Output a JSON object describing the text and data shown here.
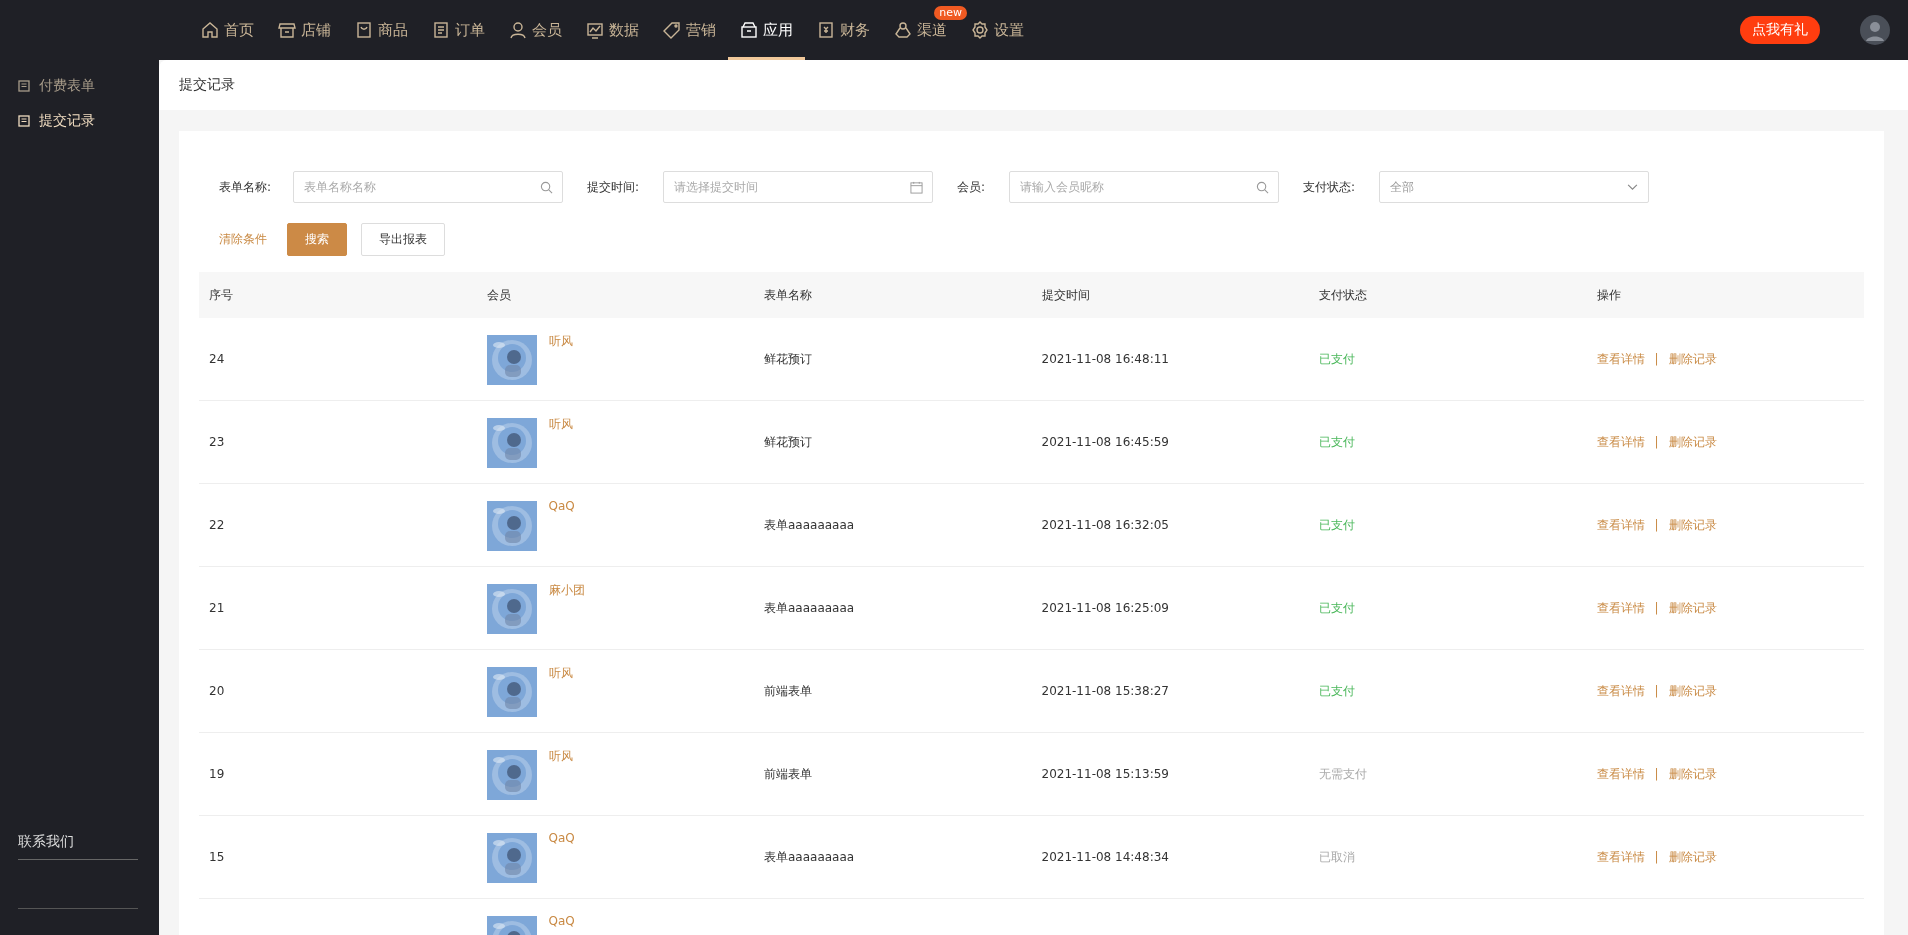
{
  "nav": {
    "items": [
      {
        "label": "首页",
        "selected": false
      },
      {
        "label": "店铺",
        "selected": false
      },
      {
        "label": "商品",
        "selected": false
      },
      {
        "label": "订单",
        "selected": false
      },
      {
        "label": "会员",
        "selected": false
      },
      {
        "label": "数据",
        "selected": false
      },
      {
        "label": "营销",
        "selected": false
      },
      {
        "label": "应用",
        "selected": true
      },
      {
        "label": "财务",
        "selected": false
      },
      {
        "label": "渠道",
        "selected": false,
        "badge": "new"
      },
      {
        "label": "设置",
        "selected": false
      }
    ],
    "promo_button": "点我有礼"
  },
  "sidebar": {
    "items": [
      {
        "label": "付费表单",
        "selected": false
      },
      {
        "label": "提交记录",
        "selected": true
      }
    ],
    "footer_title": "联系我们"
  },
  "page_title": "提交记录",
  "filters": {
    "fields": [
      {
        "label": "表单名称:",
        "placeholder": "表单名称名称",
        "kind": "search"
      },
      {
        "label": "提交时间:",
        "placeholder": "请选择提交时间",
        "kind": "date"
      },
      {
        "label": "会员:",
        "placeholder": "请输入会员昵称",
        "kind": "search"
      },
      {
        "label": "支付状态:",
        "value": "全部",
        "kind": "select"
      }
    ],
    "clear_link": "清除条件",
    "search_button": "搜索",
    "export_button": "导出报表"
  },
  "table": {
    "columns": [
      "序号",
      "会员",
      "表单名称",
      "提交时间",
      "支付状态",
      "操作"
    ],
    "rows": [
      {
        "no": "24",
        "member": "听风",
        "form": "鲜花预订",
        "time": "2021-11-08 16:48:11",
        "status": {
          "text": "已支付",
          "kind": "paid"
        },
        "actions": [
          "查看详情",
          "|",
          "删除记录"
        ]
      },
      {
        "no": "23",
        "member": "听风",
        "form": "鲜花预订",
        "time": "2021-11-08 16:45:59",
        "status": {
          "text": "已支付",
          "kind": "paid"
        },
        "actions": [
          "查看详情",
          "|",
          "删除记录"
        ]
      },
      {
        "no": "22",
        "member": "QaQ",
        "form": "表单aaaaaaaaa",
        "time": "2021-11-08 16:32:05",
        "status": {
          "text": "已支付",
          "kind": "paid"
        },
        "actions": [
          "查看详情",
          "|",
          "删除记录"
        ]
      },
      {
        "no": "21",
        "member": "麻小团",
        "form": "表单aaaaaaaaa",
        "time": "2021-11-08 16:25:09",
        "status": {
          "text": "已支付",
          "kind": "paid"
        },
        "actions": [
          "查看详情",
          "|",
          "删除记录"
        ]
      },
      {
        "no": "20",
        "member": "听风",
        "form": "前端表单",
        "time": "2021-11-08 15:38:27",
        "status": {
          "text": "已支付",
          "kind": "paid"
        },
        "actions": [
          "查看详情",
          "|",
          "删除记录"
        ]
      },
      {
        "no": "19",
        "member": "听风",
        "form": "前端表单",
        "time": "2021-11-08 15:13:59",
        "status": {
          "text": "无需支付",
          "kind": "muted"
        },
        "actions": [
          "查看详情",
          "|",
          "删除记录"
        ]
      },
      {
        "no": "15",
        "member": "QaQ",
        "form": "表单aaaaaaaaa",
        "time": "2021-11-08 14:48:34",
        "status": {
          "text": "已取消",
          "kind": "muted"
        },
        "actions": [
          "查看详情",
          "|",
          "删除记录"
        ]
      },
      {
        "member": "QaQ"
      }
    ]
  }
}
